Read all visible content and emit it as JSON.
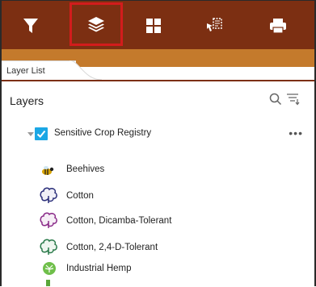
{
  "panel": {
    "tab_label": "Layer List",
    "title": "Layers"
  },
  "group": {
    "label": "Sensitive Crop Registry",
    "menu": "•••"
  },
  "layers": [
    {
      "label": "Beehives"
    },
    {
      "label": "Cotton"
    },
    {
      "label": "Cotton, Dicamba-Tolerant"
    },
    {
      "label": "Cotton, 2,4-D-Tolerant"
    },
    {
      "label": "Industrial Hemp"
    }
  ],
  "colors": {
    "toolbar": "#7c2f12",
    "strip": "#c47a2c",
    "highlight": "#d21c1c",
    "checkbox": "#1ba7e5"
  },
  "toolbar_icons": [
    "filter-icon",
    "layers-icon",
    "grid-icon",
    "select-icon",
    "print-icon"
  ]
}
